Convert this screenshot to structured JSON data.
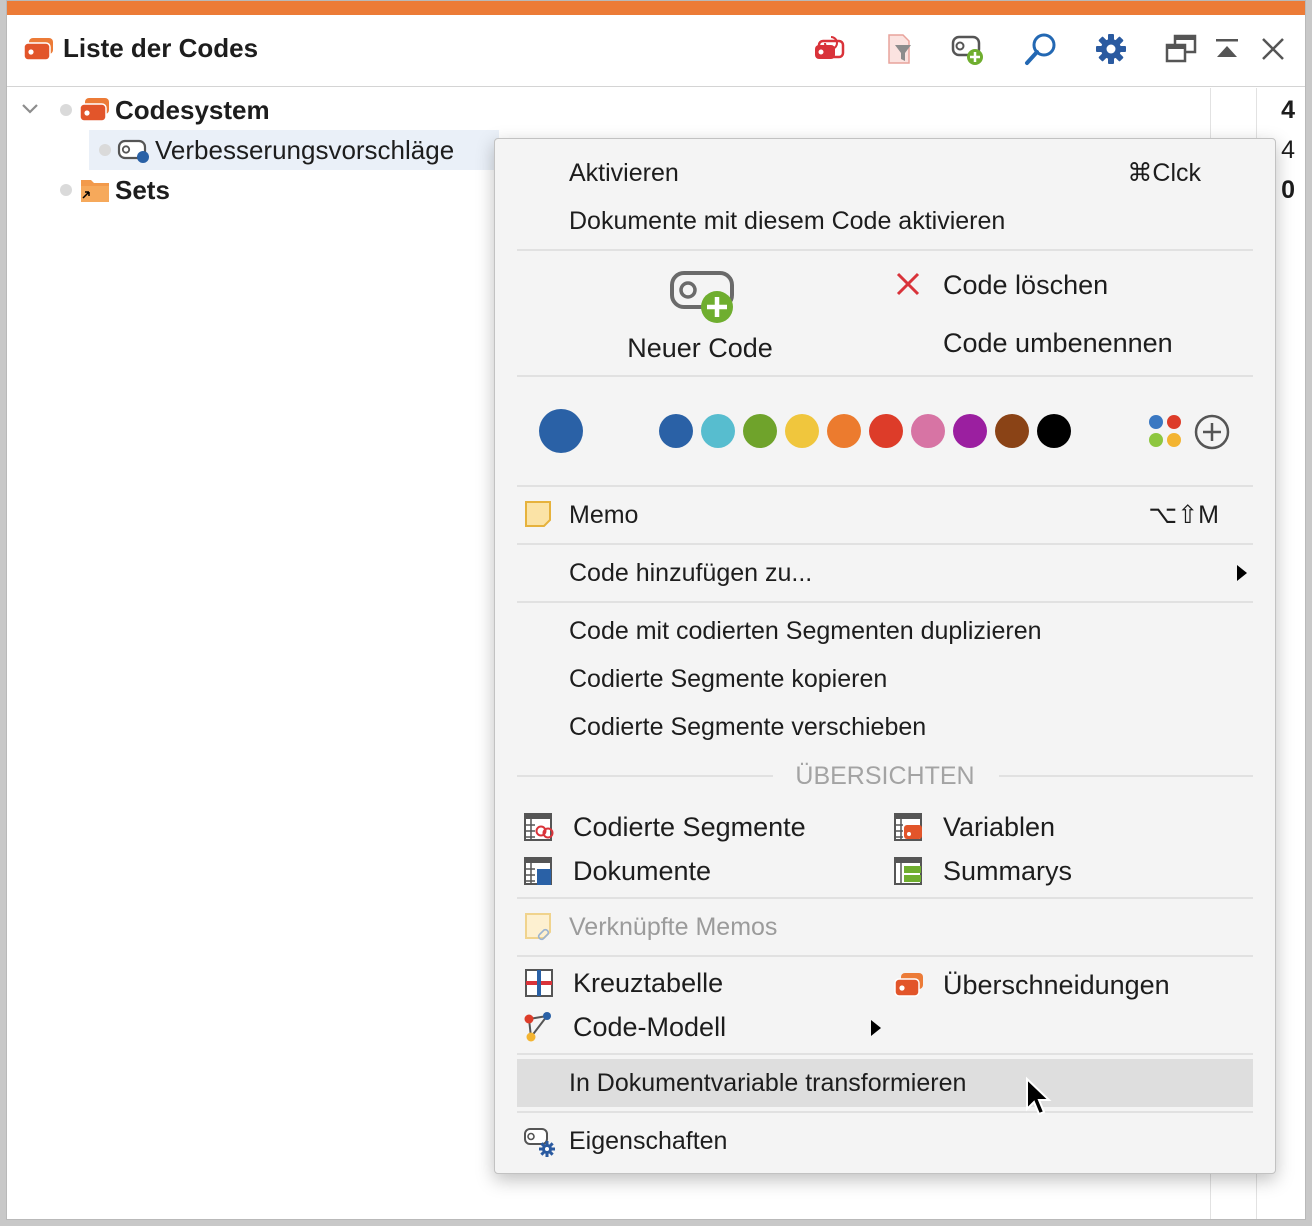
{
  "panel": {
    "title": "Liste der Codes",
    "accent_color": "#ec7b37",
    "toolbar": [
      "reset-activation-icon",
      "filter-icon",
      "new-code-icon",
      "search-icon",
      "settings-icon",
      "undock-icon",
      "collapse-icon",
      "close-icon"
    ]
  },
  "tree": [
    {
      "label": "Codesystem",
      "count": "4"
    },
    {
      "label": "Verbesserungsvorschläge",
      "count": "4"
    },
    {
      "label": "Sets",
      "count": "0"
    }
  ],
  "menu": {
    "activate": {
      "label": "Aktivieren",
      "shortcut": "⌘Clck"
    },
    "activate_docs": "Dokumente mit diesem Code aktivieren",
    "new_code": "Neuer Code",
    "delete_code": "Code löschen",
    "rename_code": "Code umbenennen",
    "current_color": "#2a61a6",
    "colors": [
      "#2a61a6",
      "#57bdcf",
      "#6fa32b",
      "#f0c63d",
      "#ec7b2e",
      "#dd3c29",
      "#d774a4",
      "#9b1fa0",
      "#8a4316",
      "#000000"
    ],
    "memo": {
      "label": "Memo",
      "shortcut": "⌥⇧M"
    },
    "add_to": "Code hinzufügen zu...",
    "duplicate": "Code mit codierten Segmenten duplizieren",
    "copy_segments": "Codierte Segmente kopieren",
    "move_segments": "Codierte Segmente verschieben",
    "overviews_header": "ÜBERSICHTEN",
    "overviews": {
      "coded_segments": "Codierte Segmente",
      "variables": "Variablen",
      "documents": "Dokumente",
      "summaries": "Summarys"
    },
    "linked_memos": "Verknüpfte Memos",
    "crosstab": "Kreuztabelle",
    "intersections": "Überschneidungen",
    "code_model": "Code-Modell",
    "transform": "In Dokumentvariable transformieren",
    "properties": "Eigenschaften"
  }
}
